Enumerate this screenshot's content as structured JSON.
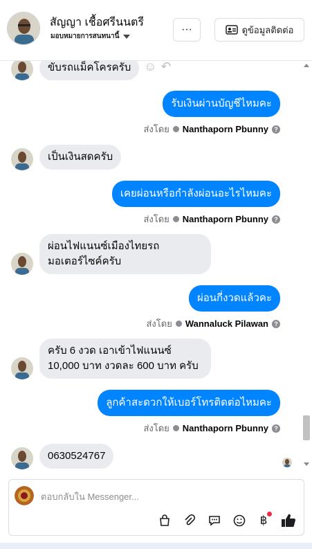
{
  "header": {
    "contact_name": "สัญญา เชื้อศรีนนตรี",
    "assigned_to": "มอบหมายการสนทนานี้",
    "more_button": "···",
    "contact_info_button": "ดูข้อมูลติดต่อ"
  },
  "thread": {
    "sent_by_prefix": "ส่งโดย",
    "messages": [
      {
        "from": "customer",
        "text": "ขับรถแม็คโครครับ"
      },
      {
        "from": "page",
        "text": "รับเงินผ่านบัญชีไหมคะ",
        "sent_by": "Nanthaporn Pbunny"
      },
      {
        "from": "customer",
        "text": "เป็นเงินสดครับ"
      },
      {
        "from": "page",
        "text": "เคยผ่อนหรือกำลังผ่อนอะไรไหมคะ",
        "sent_by": "Nanthaporn Pbunny"
      },
      {
        "from": "customer",
        "lines": [
          "ผ่อนไฟแนนซ์เมืองไทยรถ",
          "มอเตอร์ไซค์ครับ"
        ]
      },
      {
        "from": "page",
        "text": "ผ่อนกี่งวดแล้วคะ",
        "sent_by": "Wannaluck Pilawan"
      },
      {
        "from": "customer",
        "lines": [
          "ครับ 6 งวด เอาเข้าไฟแนนซ์",
          "10,000 บาท งวดละ 600 บาท ครับ"
        ]
      },
      {
        "from": "page",
        "text": "ลูกค้าสะดวกให้เบอร์โทรติดต่อไหมคะ",
        "sent_by": "Nanthaporn Pbunny"
      },
      {
        "from": "customer",
        "text": "0630524767"
      }
    ]
  },
  "composer": {
    "placeholder": "ตอบกลับใน Messenger..."
  },
  "icons": {
    "tools": [
      "shopping-bag-icon",
      "paperclip-icon",
      "saved-reply-icon",
      "emoji-icon",
      "baht-payment-icon",
      "thumbs-up-icon"
    ]
  },
  "colors": {
    "outgoing_bubble": "#0084ff",
    "incoming_bubble": "#e9ebee",
    "like_icon": "#1c1e21",
    "notification_dot": "#f02849"
  }
}
